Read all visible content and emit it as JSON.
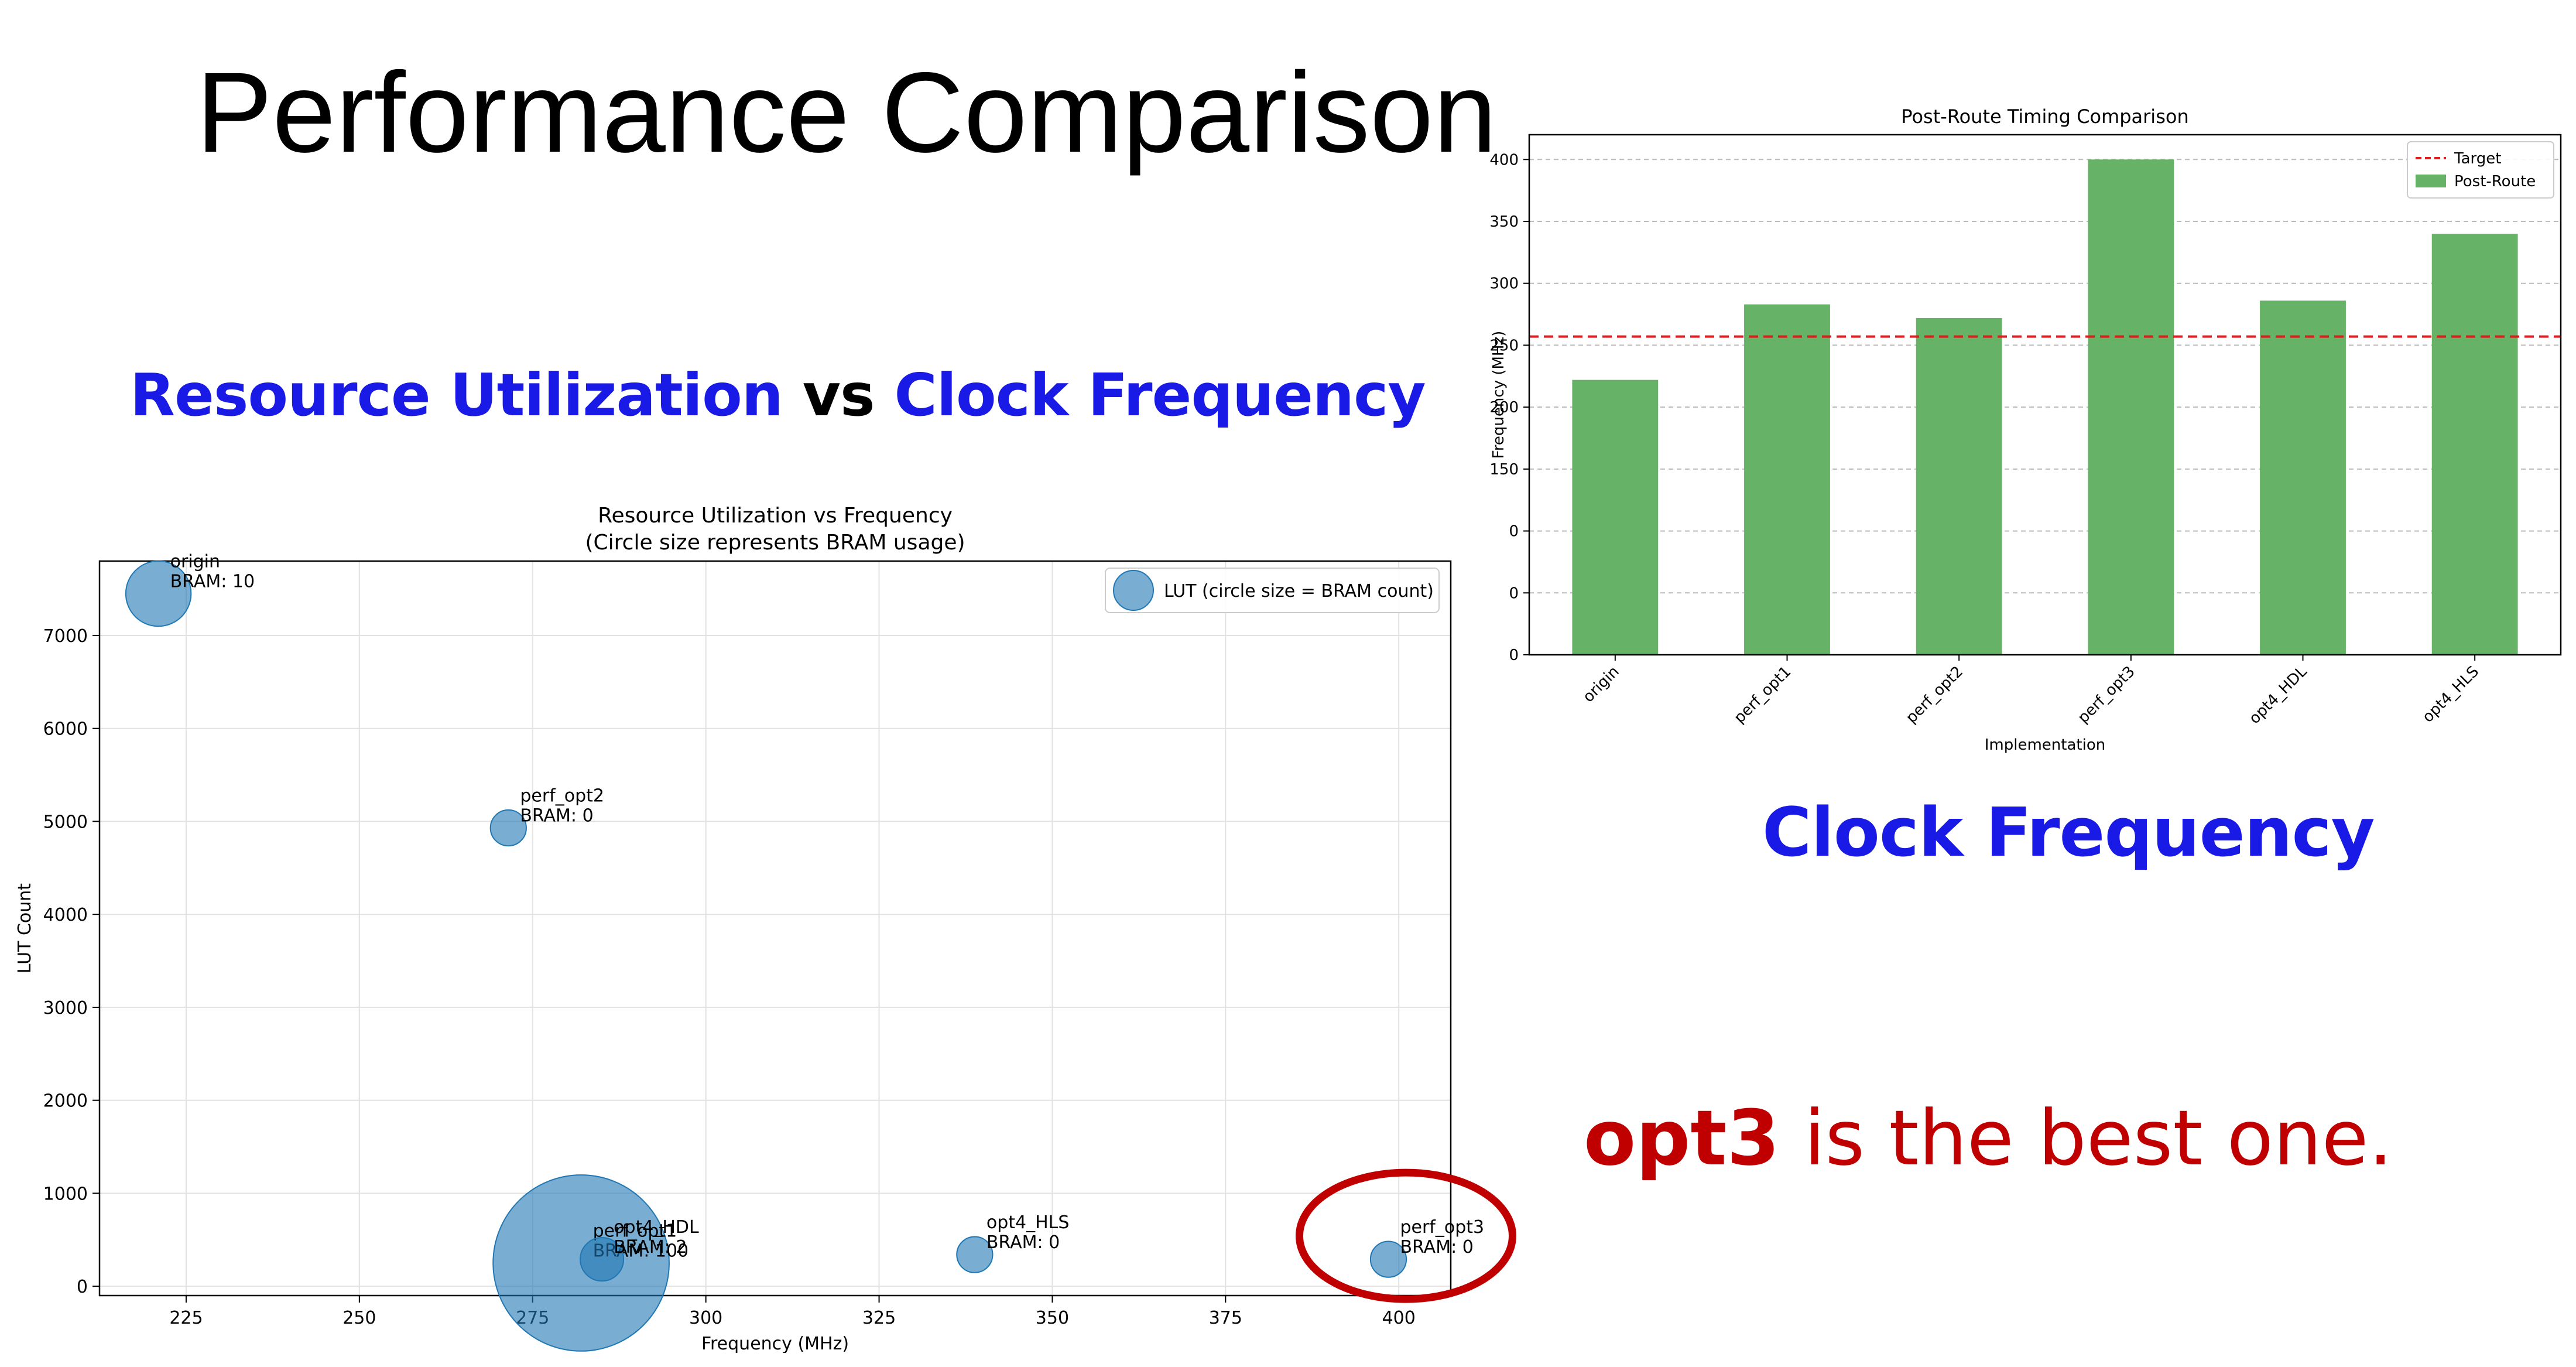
{
  "slide": {
    "title": "Performance Comparison",
    "subtitle_left": [
      "Resource Utilization",
      " vs ",
      "Clock Frequency"
    ],
    "subtitle_right": "Clock Frequency",
    "conclusion_bold": "opt3",
    "conclusion_rest": " is the best one.",
    "colors": {
      "blue": "#1a1ae6",
      "black": "#000000",
      "red": "#c00000"
    }
  },
  "chart_data": [
    {
      "type": "scatter",
      "title": "Resource Utilization vs Frequency",
      "subtitle": "(Circle size represents BRAM usage)",
      "xlabel": "Frequency (MHz)",
      "ylabel": "LUT Count",
      "xlim": [
        212.5,
        407.5
      ],
      "ylim": [
        -100,
        7800
      ],
      "xticks": [
        225,
        250,
        275,
        300,
        325,
        350,
        375,
        400
      ],
      "yticks": [
        0,
        1000,
        2000,
        3000,
        4000,
        5000,
        6000,
        7000
      ],
      "grid": true,
      "legend": {
        "label": "LUT (circle size = BRAM count)",
        "placement": "top-right"
      },
      "color": "#1f77b4",
      "points": [
        {
          "name": "origin",
          "label_lines": [
            "origin",
            "BRAM: 10"
          ],
          "x": 221,
          "y": 7450,
          "bram": 10
        },
        {
          "name": "perf_opt1",
          "label_lines": [
            "perf_opt1",
            "BRAM: 100"
          ],
          "x": 282,
          "y": 250,
          "bram": 100
        },
        {
          "name": "perf_opt2",
          "label_lines": [
            "perf_opt2",
            "BRAM: 0"
          ],
          "x": 271.5,
          "y": 4930,
          "bram": 0
        },
        {
          "name": "perf_opt3",
          "label_lines": [
            "perf_opt3",
            "BRAM: 0"
          ],
          "x": 398.5,
          "y": 290,
          "bram": 0
        },
        {
          "name": "opt4_HDL",
          "label_lines": [
            "opt4_HDL",
            "BRAM: 2"
          ],
          "x": 285,
          "y": 290,
          "bram": 2
        },
        {
          "name": "opt4_HLS",
          "label_lines": [
            "opt4_HLS",
            "BRAM: 0"
          ],
          "x": 338.8,
          "y": 340,
          "bram": 0
        }
      ],
      "highlight": {
        "target": "perf_opt3",
        "color": "#c00000"
      }
    },
    {
      "type": "bar",
      "title": "Post-Route Timing Comparison",
      "xlabel": "Implementation",
      "ylabel": "Frequency (MHz)",
      "categories": [
        "origin",
        "perf_opt1",
        "perf_opt2",
        "perf_opt3",
        "opt4_HDL",
        "opt4_HLS"
      ],
      "series": [
        {
          "name": "Post-Route",
          "values": [
            222,
            283,
            272,
            400,
            286,
            340
          ],
          "color": "#66b266"
        }
      ],
      "target": {
        "name": "Target",
        "value": 257,
        "color": "#e31a1c"
      },
      "ylim": [
        0,
        420
      ],
      "yticks": [
        0,
        50,
        100,
        150,
        200,
        250,
        300,
        350,
        400
      ],
      "ytick_labels": [
        "0",
        "0",
        "0",
        "150",
        "200",
        "250",
        "300",
        "350",
        "400"
      ],
      "grid": "y",
      "legend": {
        "placement": "top-right"
      }
    }
  ]
}
